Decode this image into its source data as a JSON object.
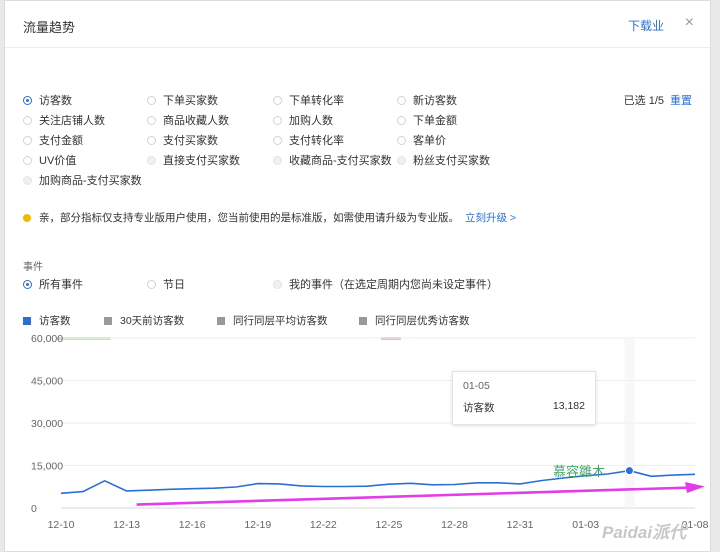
{
  "header": {
    "title": "流量趋势",
    "download": "下载",
    "download_icon": "下载业",
    "close": "×"
  },
  "metrics": [
    {
      "label": "访客数",
      "state": "selected"
    },
    {
      "label": "下单买家数",
      "state": "normal"
    },
    {
      "label": "下单转化率",
      "state": "normal"
    },
    {
      "label": "新访客数",
      "state": "normal"
    },
    {
      "label": "关注店铺人数",
      "state": "normal"
    },
    {
      "label": "商品收藏人数",
      "state": "normal"
    },
    {
      "label": "加购人数",
      "state": "normal"
    },
    {
      "label": "下单金额",
      "state": "normal"
    },
    {
      "label": "支付金额",
      "state": "normal"
    },
    {
      "label": "支付买家数",
      "state": "normal"
    },
    {
      "label": "支付转化率",
      "state": "normal"
    },
    {
      "label": "客单价",
      "state": "normal"
    },
    {
      "label": "UV价值",
      "state": "normal"
    },
    {
      "label": "直接支付买家数",
      "state": "disabled"
    },
    {
      "label": "收藏商品-支付买家数",
      "state": "disabled"
    },
    {
      "label": "粉丝支付买家数",
      "state": "disabled"
    },
    {
      "label": "加购商品-支付买家数",
      "state": "disabled"
    }
  ],
  "selection": {
    "count_text": "已选 1/5",
    "reset": "重置"
  },
  "notice": {
    "text": "亲，部分指标仅支持专业版用户使用，您当前使用的是标准版，如需使用请升级为专业版。",
    "link": "立刻升级 >"
  },
  "events": {
    "label": "事件",
    "options": [
      {
        "label": "所有事件",
        "state": "selected"
      },
      {
        "label": "节日",
        "state": "normal"
      },
      {
        "label": "我的事件（在选定周期内您尚未设定事件）",
        "state": "disabled"
      }
    ]
  },
  "legend": [
    {
      "name": "访客数",
      "color": "#2b6fd6"
    },
    {
      "name": "30天前访客数",
      "color": "#9a9a9a"
    },
    {
      "name": "同行同层平均访客数",
      "color": "#9a9a9a"
    },
    {
      "name": "同行同层优秀访客数",
      "color": "#9a9a9a"
    }
  ],
  "colors": {
    "accent": "#2b6fd6",
    "arrow": "#e23de8",
    "holiday_green": "#c8e6b6",
    "holiday_pink": "#f5b7c5"
  },
  "chart_data": {
    "type": "line",
    "y_ticks": [
      "0",
      "15,000",
      "30,000",
      "45,000",
      "60,000"
    ],
    "ylim": [
      0,
      60000
    ],
    "x_ticks": [
      "12-10",
      "12-13",
      "12-16",
      "12-19",
      "12-22",
      "12-25",
      "12-28",
      "12-31",
      "01-03",
      "01-08"
    ],
    "series": [
      {
        "name": "访客数",
        "x": [
          "12-10",
          "12-11",
          "12-12",
          "12-13",
          "12-14",
          "12-15",
          "12-16",
          "12-17",
          "12-18",
          "12-19",
          "12-20",
          "12-21",
          "12-22",
          "12-23",
          "12-24",
          "12-25",
          "12-26",
          "12-27",
          "12-28",
          "12-29",
          "12-30",
          "12-31",
          "01-01",
          "01-02",
          "01-03",
          "01-04",
          "01-05",
          "01-06",
          "01-07",
          "01-08"
        ],
        "values": [
          5200,
          5800,
          9600,
          6000,
          6300,
          6600,
          6800,
          7000,
          7400,
          8600,
          8500,
          7800,
          7600,
          7600,
          7700,
          8400,
          8700,
          8200,
          8300,
          8900,
          8900,
          8500,
          9700,
          10600,
          11400,
          12000,
          13182,
          11200,
          11600,
          11900
        ]
      }
    ],
    "tooltip": {
      "date": "01-05",
      "name": "访客数",
      "value": "13,182"
    },
    "annotation_color": "#e23de8"
  },
  "watermarks": {
    "w1": "慕容雛木",
    "w2": "Paidai派代"
  }
}
